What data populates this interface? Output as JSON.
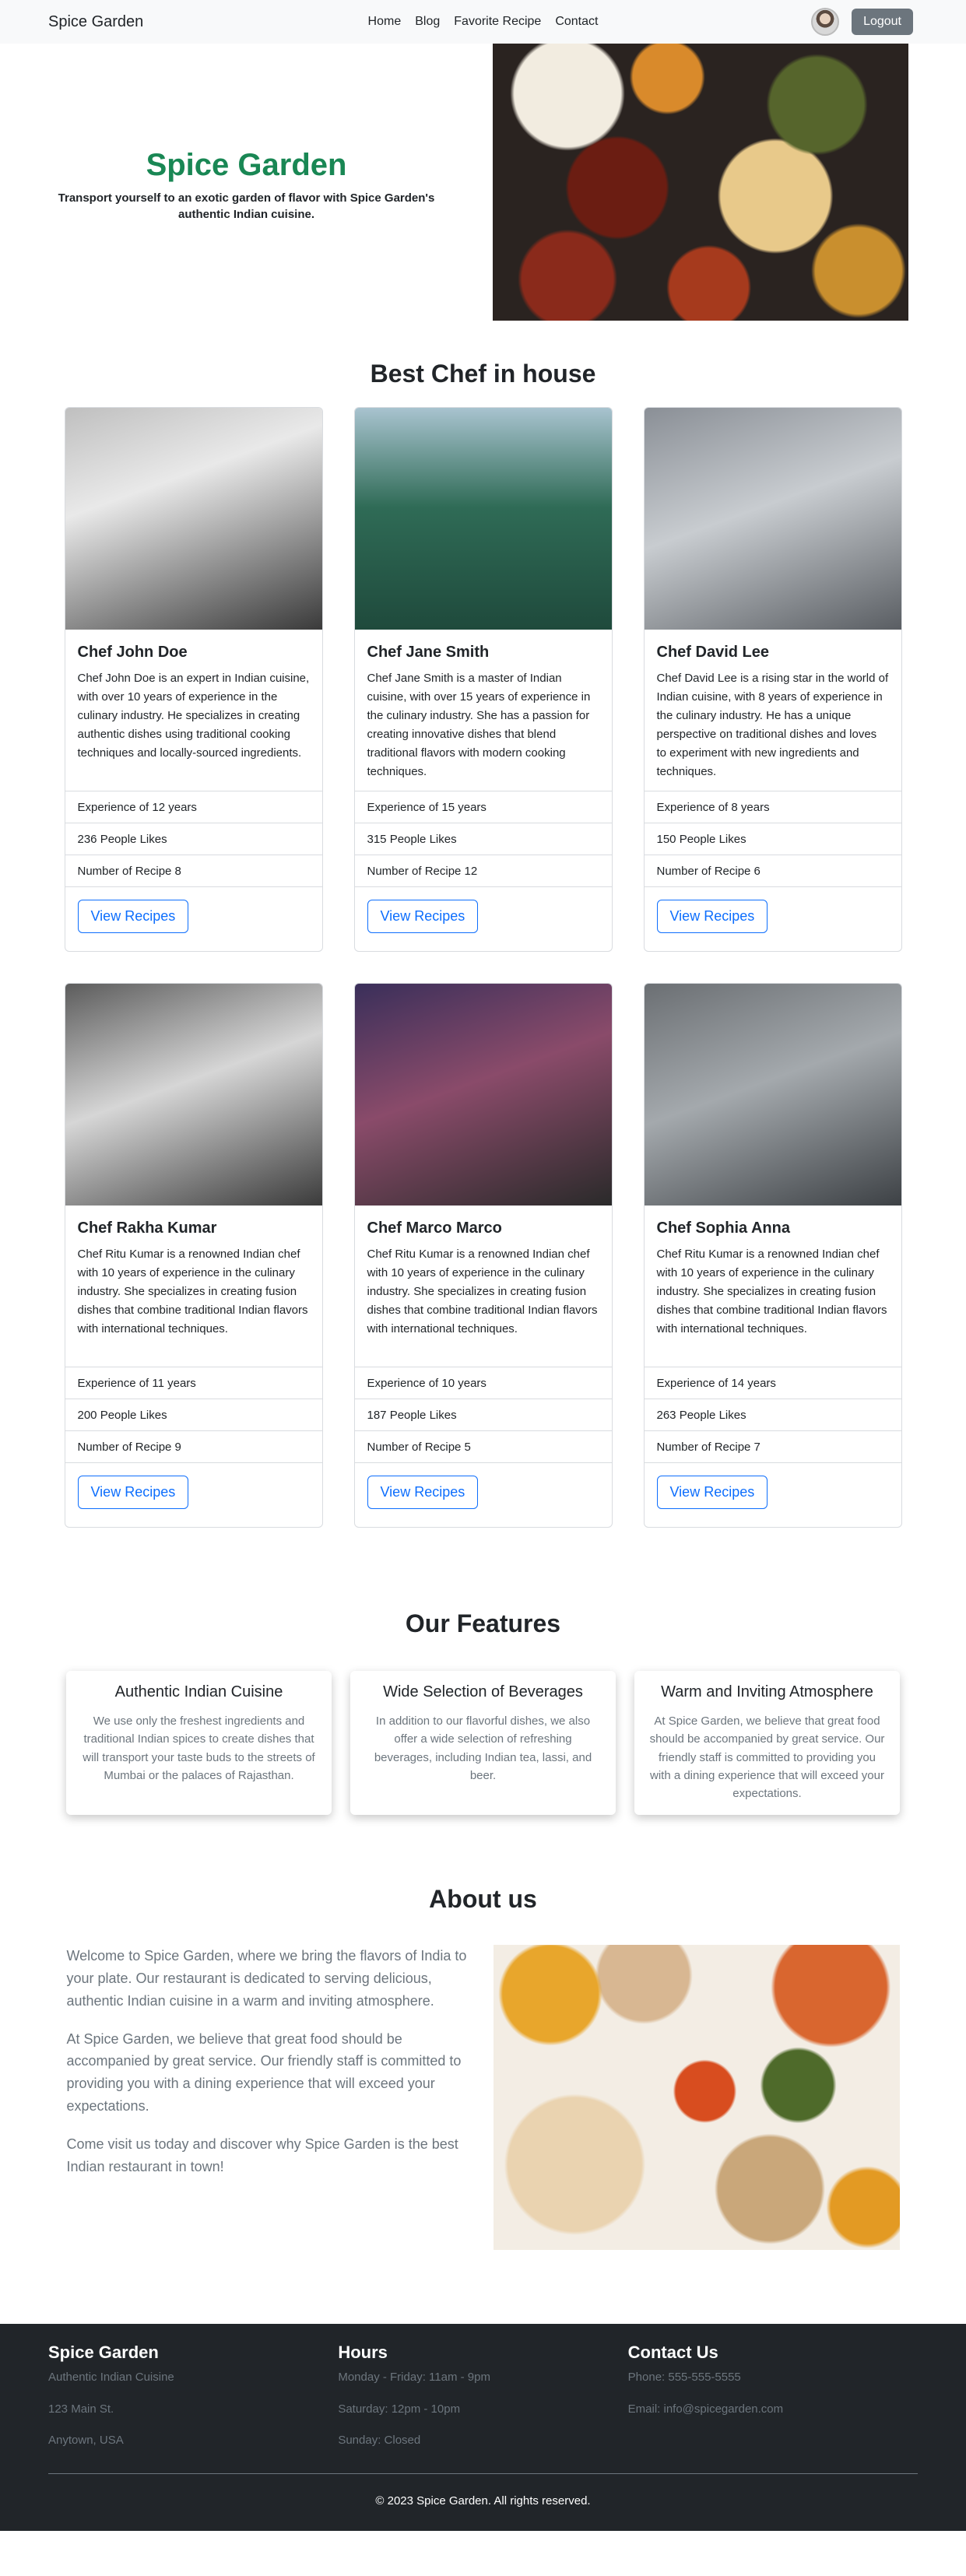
{
  "nav": {
    "brand": "Spice Garden",
    "links": [
      "Home",
      "Blog",
      "Favorite Recipe",
      "Contact"
    ],
    "logout": "Logout"
  },
  "hero": {
    "title": "Spice Garden",
    "subtitle": "Transport yourself to an exotic garden of flavor with Spice Garden's authentic Indian cuisine."
  },
  "chefs_section": {
    "title": "Best Chef in house",
    "chefs": [
      {
        "name": "Chef John Doe",
        "bio": "Chef John Doe is an expert in Indian cuisine, with over 10 years of experience in the culinary industry. He specializes in creating authentic dishes using traditional cooking techniques and locally-sourced ingredients.",
        "experience": "Experience of 12 years",
        "likes": "236 People Likes",
        "recipes": "Number of Recipe 8",
        "button": "View Recipes"
      },
      {
        "name": "Chef Jane Smith",
        "bio": "Chef Jane Smith is a master of Indian cuisine, with over 15 years of experience in the culinary industry. She has a passion for creating innovative dishes that blend traditional flavors with modern cooking techniques.",
        "experience": "Experience of 15 years",
        "likes": "315 People Likes",
        "recipes": "Number of Recipe 12",
        "button": "View Recipes"
      },
      {
        "name": "Chef David Lee",
        "bio": "Chef David Lee is a rising star in the world of Indian cuisine, with 8 years of experience in the culinary industry. He has a unique perspective on traditional dishes and loves to experiment with new ingredients and techniques.",
        "experience": "Experience of 8 years",
        "likes": "150 People Likes",
        "recipes": "Number of Recipe 6",
        "button": "View Recipes"
      },
      {
        "name": "Chef Rakha Kumar",
        "bio": "Chef Ritu Kumar is a renowned Indian chef with 10 years of experience in the culinary industry. She specializes in creating fusion dishes that combine traditional Indian flavors with international techniques.",
        "experience": "Experience of 11 years",
        "likes": "200 People Likes",
        "recipes": "Number of Recipe 9",
        "button": "View Recipes"
      },
      {
        "name": "Chef Marco Marco",
        "bio": "Chef Ritu Kumar is a renowned Indian chef with 10 years of experience in the culinary industry. She specializes in creating fusion dishes that combine traditional Indian flavors with international techniques.",
        "experience": "Experience of 10 years",
        "likes": "187 People Likes",
        "recipes": "Number of Recipe 5",
        "button": "View Recipes"
      },
      {
        "name": "Chef Sophia Anna",
        "bio": "Chef Ritu Kumar is a renowned Indian chef with 10 years of experience in the culinary industry. She specializes in creating fusion dishes that combine traditional Indian flavors with international techniques.",
        "experience": "Experience of 14 years",
        "likes": "263 People Likes",
        "recipes": "Number of Recipe 7",
        "button": "View Recipes"
      }
    ]
  },
  "features": {
    "title": "Our Features",
    "items": [
      {
        "title": "Authentic Indian Cuisine",
        "text": "We use only the freshest ingredients and traditional Indian spices to create dishes that will transport your taste buds to the streets of Mumbai or the palaces of Rajasthan."
      },
      {
        "title": "Wide Selection of Beverages",
        "text": "In addition to our flavorful dishes, we also offer a wide selection of refreshing beverages, including Indian tea, lassi, and beer."
      },
      {
        "title": "Warm and Inviting Atmosphere",
        "text": "At Spice Garden, we believe that great food should be accompanied by great service. Our friendly staff is committed to providing you with a dining experience that will exceed your expectations."
      }
    ]
  },
  "about": {
    "title": "About us",
    "paragraphs": [
      "Welcome to Spice Garden, where we bring the flavors of India to your plate. Our restaurant is dedicated to serving delicious, authentic Indian cuisine in a warm and inviting atmosphere.",
      "At Spice Garden, we believe that great food should be accompanied by great service. Our friendly staff is committed to providing you with a dining experience that will exceed your expectations.",
      "Come visit us today and discover why Spice Garden is the best Indian restaurant in town!"
    ]
  },
  "footer": {
    "col1": {
      "title": "Spice Garden",
      "lines": [
        "Authentic Indian Cuisine",
        "123 Main St.",
        "Anytown, USA"
      ]
    },
    "col2": {
      "title": "Hours",
      "lines": [
        "Monday - Friday: 11am - 9pm",
        "Saturday: 12pm - 10pm",
        "Sunday: Closed"
      ]
    },
    "col3": {
      "title": "Contact Us",
      "lines": [
        "Phone: 555-555-5555",
        "Email: info@spicegarden.com"
      ]
    },
    "copyright": "© 2023 Spice Garden. All rights reserved."
  },
  "colors": {
    "accent_green": "#198754",
    "primary_blue": "#0d6efd",
    "footer_bg": "#212529",
    "muted": "#6c757d"
  }
}
